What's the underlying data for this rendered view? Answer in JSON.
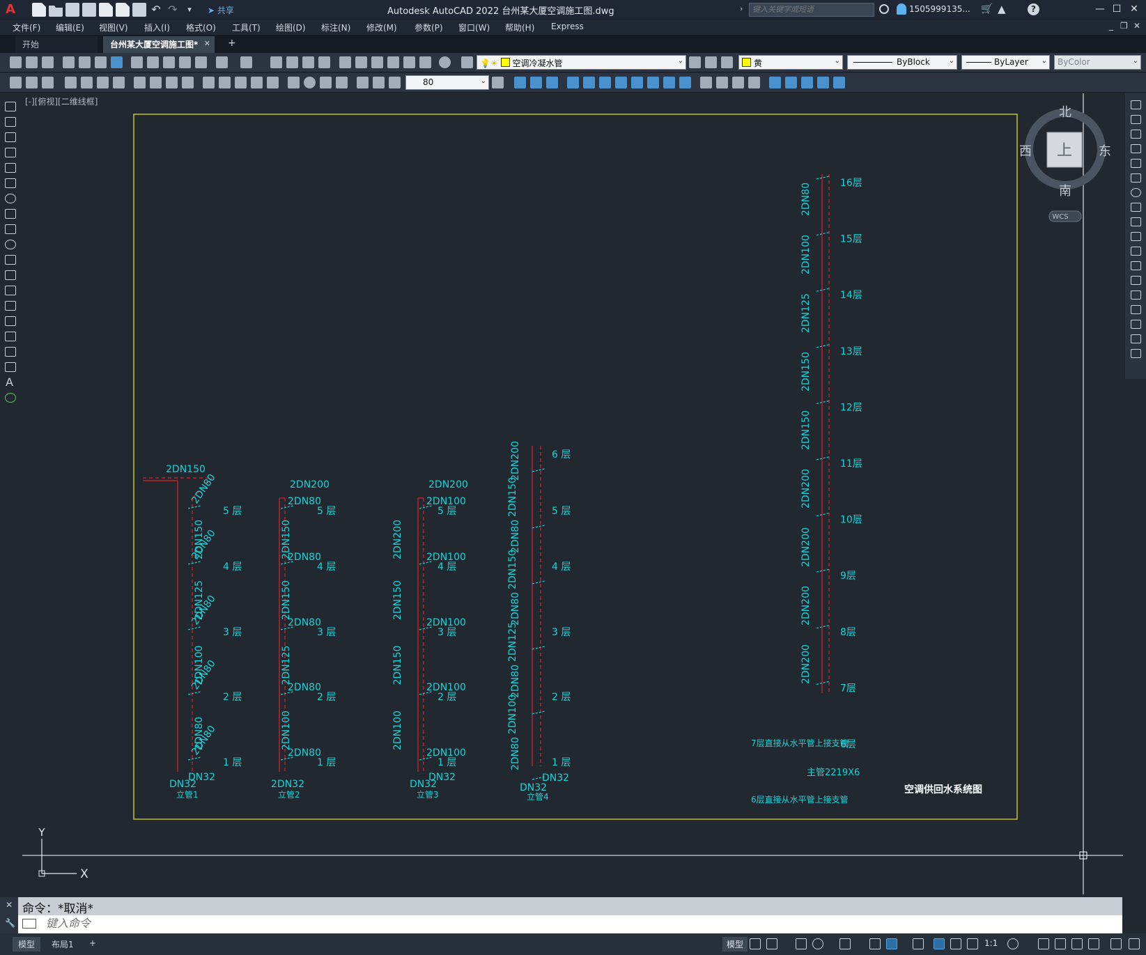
{
  "app": {
    "title": "Autodesk AutoCAD 2022    台州某大厦空调施工图.dwg",
    "share_label": "共享",
    "search_placeholder": "键入关键字或短语",
    "user": "1505999135...",
    "win_minimize": "—",
    "win_maximize": "☐",
    "win_close": "✕"
  },
  "menu": [
    "文件(F)",
    "编辑(E)",
    "视图(V)",
    "插入(I)",
    "格式(O)",
    "工具(T)",
    "绘图(D)",
    "标注(N)",
    "修改(M)",
    "参数(P)",
    "窗口(W)",
    "帮助(H)",
    "Express"
  ],
  "tabs": {
    "start": "开始",
    "active": "台州某大厦空调施工图*",
    "close": "✕",
    "add": "+"
  },
  "toolbar": {
    "layer_name": "空调冷凝水管",
    "color_name": "黄",
    "linetype": "ByBlock",
    "lineweight": "ByLayer",
    "plotstyle": "ByColor",
    "dim_value": "80"
  },
  "viewport_label": "[-][俯视][二维线框]",
  "viewcube": {
    "north": "北",
    "south": "南",
    "east": "东",
    "west": "西",
    "top": "上",
    "wcs": "WCS"
  },
  "ucs": {
    "x": "X",
    "y": "Y"
  },
  "drawing": {
    "title": "空调供回水系统图",
    "note_7": "7层直接从水平管上接支管",
    "note_6": "6层直接从水平管上接支管",
    "main_pipe": "主管2219X6",
    "risers": [
      {
        "label": "立管1",
        "top": "2DN150",
        "dn32_a": "DN32",
        "dn32_b": "DN32",
        "branches": [
          "2DN80",
          "2DN80",
          "2DN80",
          "2DN80",
          "2DN80"
        ],
        "vertical": [
          "2DN150",
          "2DN125",
          "2DN100",
          "2DN80"
        ],
        "floors": [
          "5 层",
          "4 层",
          "3 层",
          "2 层",
          "1 层"
        ]
      },
      {
        "label": "立管2",
        "top": "2DN200",
        "dn32_a": "2DN32",
        "branches": [
          "2DN80",
          "2DN80",
          "2DN80",
          "2DN80",
          "2DN80"
        ],
        "vertical": [
          "2DN150",
          "2DN150",
          "2DN125",
          "2DN100"
        ],
        "floors": [
          "5 层",
          "4 层",
          "3 层",
          "2 层",
          "1 层"
        ]
      },
      {
        "label": "立管3",
        "top": "2DN200",
        "dn32_a": "DN32",
        "dn32_b": "DN32",
        "branches": [
          "2DN100",
          "2DN100",
          "2DN100",
          "2DN100",
          "2DN100"
        ],
        "vertical": [
          "2DN200",
          "2DN150",
          "2DN150",
          "2DN100"
        ],
        "floors": [
          "5 层",
          "4 层",
          "3 层",
          "2 层",
          "1 层"
        ]
      },
      {
        "label": "立管4",
        "dn32_a": "DN32",
        "dn32_b": "DN32",
        "vertical": [
          "2DN200",
          "2DN150",
          "2DN80",
          "2DN150",
          "2DN80",
          "2DN125",
          "2DN80",
          "2DN100",
          "2DN80"
        ],
        "floors": [
          "6 层",
          "5 层",
          "4 层",
          "3 层",
          "2 层",
          "1 层"
        ]
      }
    ],
    "tall_riser": {
      "vertical": [
        "2DN80",
        "2DN100",
        "2DN125",
        "2DN150",
        "2DN150",
        "2DN200",
        "2DN200",
        "2DN200",
        "2DN200"
      ],
      "floors": [
        "16层",
        "15层",
        "14层",
        "13层",
        "12层",
        "11层",
        "10层",
        "9层",
        "8层",
        "7层",
        "6层"
      ]
    }
  },
  "command": {
    "history": "命令：*取消*",
    "placeholder": "键入命令"
  },
  "status": {
    "layout_tabs": [
      "模型",
      "布局1"
    ],
    "add_tab": "+",
    "model": "模型",
    "scale": "1:1"
  }
}
